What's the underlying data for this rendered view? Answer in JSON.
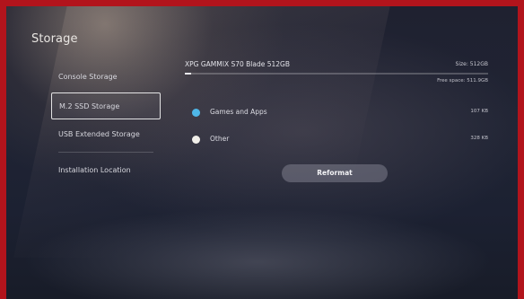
{
  "page": {
    "title": "Storage"
  },
  "sidebar": {
    "items": [
      {
        "label": "Console Storage",
        "selected": false
      },
      {
        "label": "M.2 SSD Storage",
        "selected": true
      },
      {
        "label": "USB Extended Storage",
        "selected": false
      },
      {
        "label": "Installation Location",
        "selected": false
      }
    ]
  },
  "drive": {
    "name": "XPG GAMMIX S70 Blade 512GB",
    "size_text": "Size: 512GB",
    "free_space_text": "Free space: 511.9GB",
    "used_fraction": 0.02
  },
  "categories": [
    {
      "label": "Games and Apps",
      "value": "107 KB",
      "color": "#4fb7e8"
    },
    {
      "label": "Other",
      "value": "328 KB",
      "color": "#f1efe9"
    }
  ],
  "actions": {
    "reformat_label": "Reformat"
  },
  "colors": {
    "frame": "#b2141c",
    "background": "#1f2232",
    "accent": "#4fb7e8"
  }
}
